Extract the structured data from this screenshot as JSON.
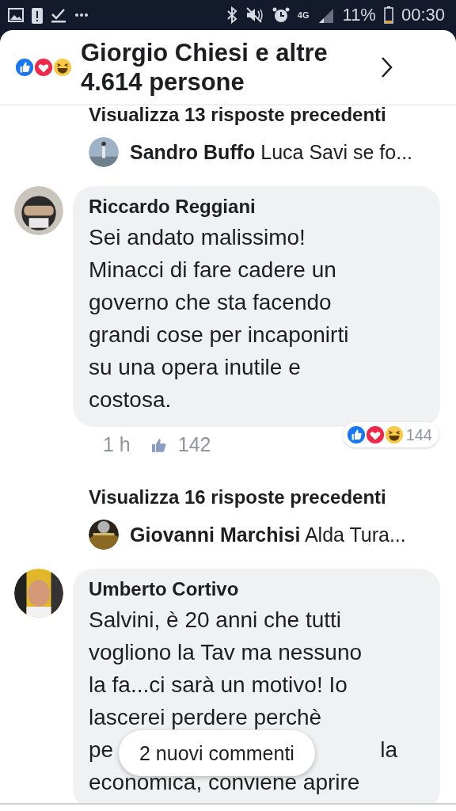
{
  "status_bar": {
    "network": "4G",
    "battery": "11%",
    "time": "00:30"
  },
  "header": {
    "title": "Giorgio Chiesi e altre 4.614 persone"
  },
  "thread": [
    {
      "kind": "more_replies",
      "text": "Visualizza 13 risposte precedenti"
    },
    {
      "kind": "reply_preview",
      "author": "Sandro Buffo",
      "text": "Luca Savi se fo..."
    },
    {
      "kind": "comment",
      "author": "Riccardo Reggiani",
      "lines": [
        [
          "Sei andato malissimo!"
        ],
        [
          "Minacci di fare cadere un"
        ],
        [
          "governo che sta facendo"
        ],
        [
          "grandi cose per incaponirti"
        ],
        [
          "su una opera inutile e"
        ],
        [
          "costosa."
        ]
      ],
      "time": "1 h",
      "likes": "142",
      "reactions": "144"
    },
    {
      "kind": "more_replies",
      "text": "Visualizza 16 risposte precedenti"
    },
    {
      "kind": "reply_preview",
      "author": "Giovanni Marchisi",
      "text": "Alda Tura..."
    },
    {
      "kind": "comment",
      "author": "Umberto Cortivo",
      "lines": [
        [
          "Salvini, è 20 anni che tutti"
        ],
        [
          "vogliono la Tav ma nessuno"
        ],
        [
          "la fa...ci sarà un motivo! Io"
        ],
        [
          "lascerei perdere perchè"
        ],
        [
          "pe",
          "la"
        ],
        [
          "economica, conviene aprire"
        ]
      ]
    }
  ],
  "toast": {
    "text": "2 nuovi commenti"
  }
}
